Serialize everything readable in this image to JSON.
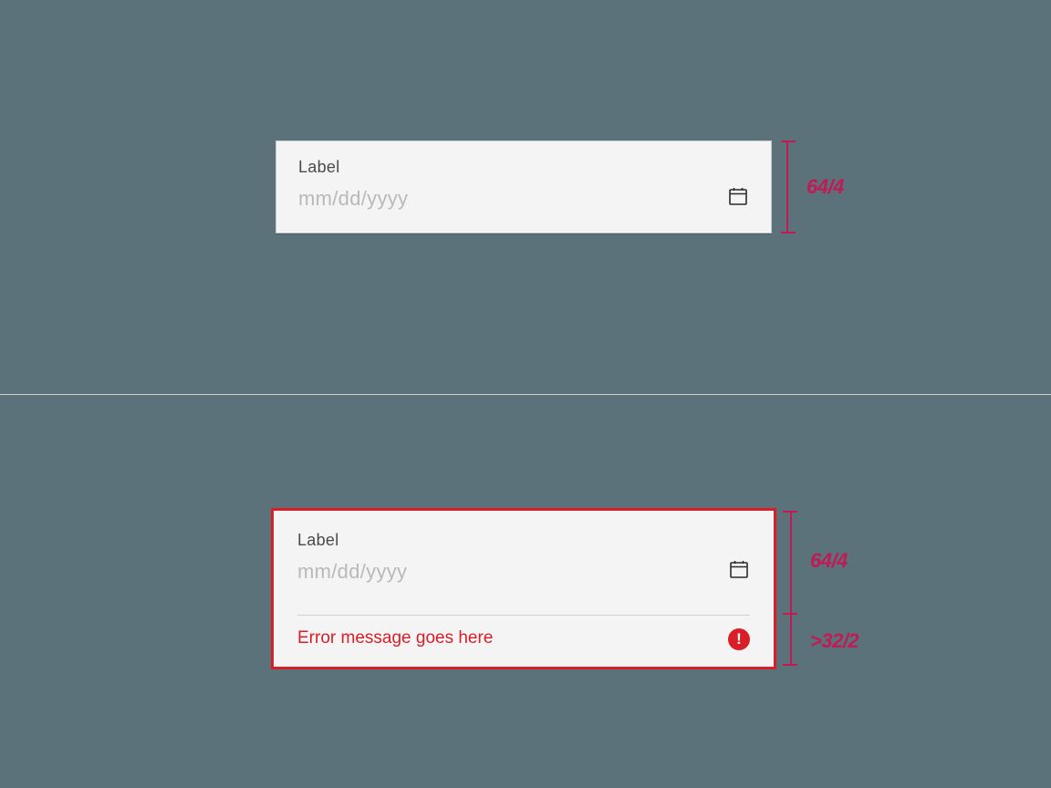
{
  "example_normal": {
    "label": "Label",
    "placeholder": "mm/dd/yyyy",
    "spec_height": "64/4"
  },
  "example_error": {
    "label": "Label",
    "placeholder": "mm/dd/yyyy",
    "error_message": "Error message goes here",
    "spec_top": "64/4",
    "spec_bottom": ">32/2"
  },
  "colors": {
    "background": "#5b727a",
    "field_bg": "#f4f4f4",
    "label_text": "#4a4a4a",
    "placeholder_text": "#b9b9b9",
    "error": "#da1e28",
    "spec": "#c11b56"
  }
}
